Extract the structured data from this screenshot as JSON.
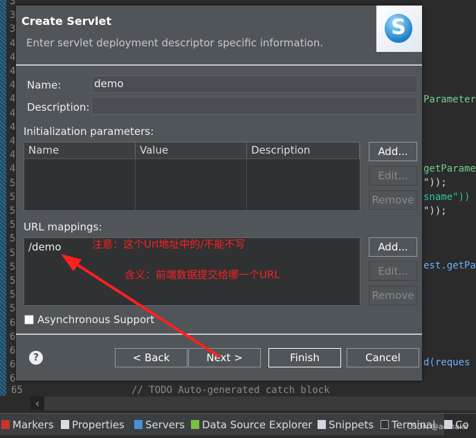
{
  "editor": {
    "line_numbers": [
      "3",
      "3",
      "3",
      "4",
      "4",
      "4",
      "4",
      "4",
      "4",
      "4",
      "4",
      "4",
      "4",
      "5",
      "5",
      "5",
      "5",
      "5",
      "5",
      "5",
      "5",
      "5",
      "5",
      "6",
      "6",
      "6",
      "6",
      "6",
      "65"
    ],
    "code_fragments": [
      "Parameter",
      "getParame",
      "\"));",
      "sname\"))",
      "\"));",
      "est.getPa",
      "d(reques",
      "// TODO Auto-generated catch block"
    ]
  },
  "dialog": {
    "title": "Create Servlet",
    "subtitle": "Enter servlet deployment descriptor specific information.",
    "logo_letter": "S",
    "name_label": "Name:",
    "name_value": "demo",
    "description_label": "Description:",
    "description_value": "",
    "init_params_label": "Initialization parameters:",
    "init_columns": [
      "Name",
      "Value",
      "Description"
    ],
    "url_mappings_label": "URL mappings:",
    "url_mappings": [
      "/demo"
    ],
    "add": "Add...",
    "edit": "Edit...",
    "remove": "Remove",
    "async_label": "Asynchronous Support",
    "async_checked": false,
    "back": "< Back",
    "next": "Next >",
    "finish": "Finish",
    "cancel": "Cancel"
  },
  "annotations": {
    "note1": "注意：这个Url地址中的/不能不写",
    "note2": "含义：前端数据提交给哪一个URL",
    "color": "#ff2020"
  },
  "bottom_tabs": [
    "Markers",
    "Properties",
    "Servers",
    "Data Source Explorer",
    "Snippets",
    "Terminal",
    "Co"
  ],
  "watermark": "CSDN @acmaks"
}
